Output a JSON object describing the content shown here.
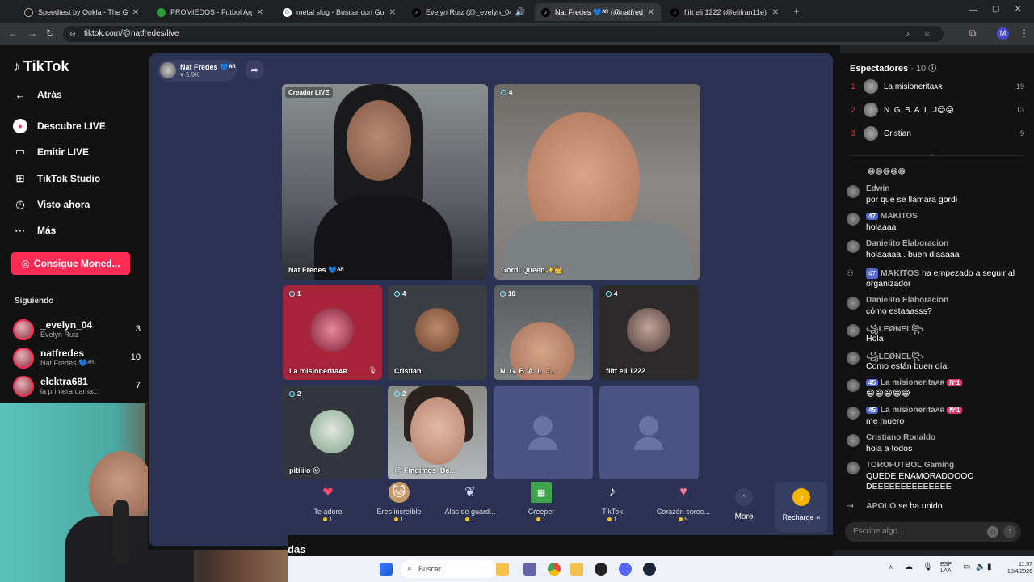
{
  "browser": {
    "tabs": [
      {
        "title": "Speedtest by Ookla - The Global"
      },
      {
        "title": "PROMIEDOS - Futbol Argentino"
      },
      {
        "title": "metal slug - Buscar con Google"
      },
      {
        "title": "Evelyn Ruiz (@_evelyn_04)"
      },
      {
        "title": "Nat Fredes 💙ᴬᴿ (@natfred"
      },
      {
        "title": "flitt eli 1222 (@elifran11e) | TikTok"
      }
    ],
    "url": "tiktok.com/@natfredes/live",
    "profile_initial": "M"
  },
  "sidebar": {
    "logo": "TikTok",
    "back": "Atrás",
    "nav": [
      {
        "label": "Descubre LIVE",
        "icon": "live-icon"
      },
      {
        "label": "Emitir LIVE",
        "icon": "camera-icon"
      },
      {
        "label": "TikTok Studio",
        "icon": "studio-icon"
      },
      {
        "label": "Visto ahora",
        "icon": "clock-icon"
      },
      {
        "label": "Más",
        "icon": "more-icon"
      }
    ],
    "coins_button": "Consigue Moned...",
    "following_heading": "Siguiendo",
    "following": [
      {
        "name": "_evelyn_04",
        "sub": "Evelyn Ruiz",
        "count": "3"
      },
      {
        "name": "natfredes",
        "sub": "Nat Fredes 💙ᴬᴿ",
        "count": "10"
      },
      {
        "name": "elektra681",
        "sub": "la primera dama...",
        "count": "7"
      }
    ]
  },
  "stage": {
    "host_name": "Nat Fredes 💙ᴬᴿ",
    "host_likes": "♥ 5.9K",
    "creator_tag": "Creador LIVE",
    "tiles": [
      {
        "label": "Nat Fredes 💙ᴬᴿ",
        "num": ""
      },
      {
        "label": "Gordi Queen✨👑",
        "num": "4"
      },
      {
        "label": "La misioneritaᴀʀ",
        "num": "1"
      },
      {
        "label": "Cristian",
        "num": "4"
      },
      {
        "label": "N. G. B. A. L. J...",
        "num": "10"
      },
      {
        "label": "flitt eli 1222",
        "num": "4"
      },
      {
        "label": "pitiiiio 😛",
        "num": "2"
      },
      {
        "label": "😊 Fingimos_De...",
        "num": "2"
      },
      {
        "label": "",
        "num": ""
      },
      {
        "label": "",
        "num": ""
      }
    ]
  },
  "gifts": [
    {
      "name": "Te adoro",
      "price": "1",
      "icon": "heart-gift-icon"
    },
    {
      "name": "Eres increíble",
      "price": "1",
      "icon": "cat-gift-icon"
    },
    {
      "name": "Alas de guard...",
      "price": "1",
      "icon": "wings-gift-icon"
    },
    {
      "name": "Creeper",
      "price": "1",
      "icon": "creeper-gift-icon"
    },
    {
      "name": "TikTok",
      "price": "1",
      "icon": "tiktok-gift-icon"
    },
    {
      "name": "Corazón coree...",
      "price": "5",
      "icon": "finger-heart-gift-icon"
    }
  ],
  "gift_more": "More",
  "recharge": "Recharge",
  "bottom_text": "das",
  "viewers": {
    "title": "Espectadores",
    "count": "· 10",
    "top": [
      {
        "rank": "1",
        "name": "La misioneritaᴀʀ",
        "score": "19"
      },
      {
        "rank": "2",
        "name": "N. G. B. A. L. J😍😝",
        "score": "13"
      },
      {
        "rank": "3",
        "name": "Cristian",
        "score": "9"
      }
    ]
  },
  "chat": {
    "emoji_row": "😄😄😄😄😄",
    "messages": [
      {
        "user": "Edwin",
        "badges": [],
        "text": "por que se llamara gordi"
      },
      {
        "user": "MAKITOS",
        "badges": [
          "47"
        ],
        "text": "holaaaa"
      },
      {
        "user": "Danielito Elaboracion",
        "badges": [],
        "text": "holaaaaa . buen diaaaaa"
      },
      {
        "user": "MAKITOS",
        "badges": [
          "47"
        ],
        "text": "ha empezado a seguir al organizador"
      },
      {
        "user": "Danielito Elaboracion",
        "badges": [],
        "text": "cómo estaaasss?"
      },
      {
        "user": "꧁LEØNEL꧂",
        "badges": [],
        "text": "Hola"
      },
      {
        "user": "꧁LEØNEL꧂",
        "badges": [],
        "text": "Como están buen día"
      },
      {
        "user": "La misioneritaᴀʀ",
        "badges": [
          "45",
          "Nº1"
        ],
        "text": "😄😄😄😄😄"
      },
      {
        "user": "La misioneritaᴀʀ",
        "badges": [
          "45",
          "Nº1"
        ],
        "text": "me muero"
      },
      {
        "user": "Cristiano Ronaldo",
        "badges": [],
        "text": "hola a todos"
      },
      {
        "user": "TOROFUTBOL Gaming",
        "badges": [],
        "text": "QUEDE ENAMORADOOOO DEEEEEEEEEEEEEE"
      },
      {
        "user": "APOLO",
        "badges": [],
        "text": "se ha unido"
      }
    ],
    "input_placeholder": "Escribe algo..."
  },
  "taskbar": {
    "search": "Buscar",
    "lang": "ESP LAA",
    "time": "11:57",
    "date": "10/4/2026"
  },
  "colors": {
    "accent": "#fe2c55",
    "stage_bg": "#2b3254",
    "panel_bg": "#121212"
  }
}
